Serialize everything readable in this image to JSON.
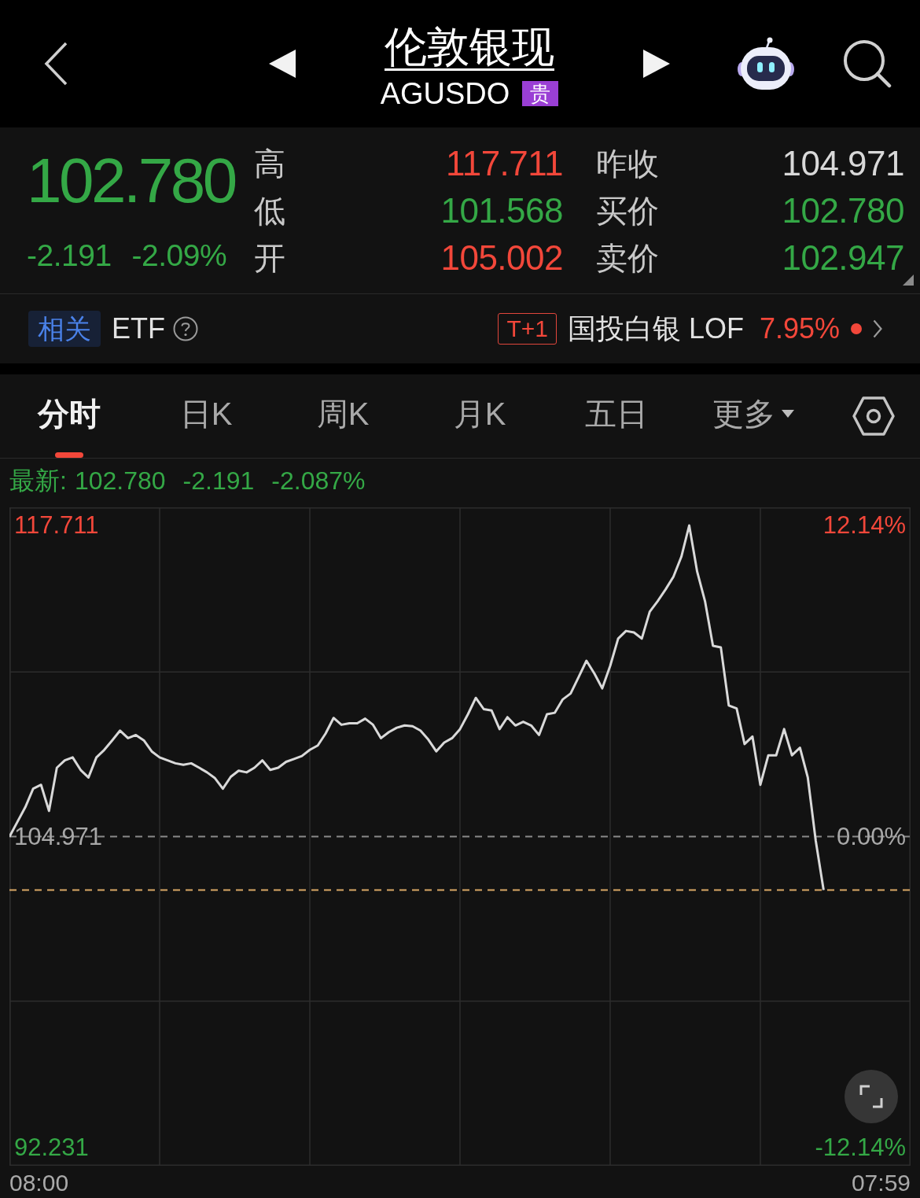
{
  "header": {
    "title": "伦敦银现",
    "code": "AGUSDO",
    "badge": "贵"
  },
  "quote": {
    "price": "102.780",
    "change": "-2.191",
    "percent": "-2.09%",
    "color": "#34a846",
    "stats": [
      {
        "label": "高",
        "value": "117.711",
        "color": "#f2473a"
      },
      {
        "label": "昨收",
        "value": "104.971",
        "color": "#d8d8d8"
      },
      {
        "label": "低",
        "value": "101.568",
        "color": "#34a846"
      },
      {
        "label": "买价",
        "value": "102.780",
        "color": "#34a846"
      },
      {
        "label": "开",
        "value": "105.002",
        "color": "#f2473a"
      },
      {
        "label": "卖价",
        "value": "102.947",
        "color": "#34a846"
      }
    ]
  },
  "related": {
    "tag": "相关",
    "label": "ETF",
    "fund": {
      "badge": "T+1",
      "name": "国投白银 LOF",
      "percent": "7.95%",
      "color": "#f2473a"
    }
  },
  "tabs": [
    {
      "label": "分时",
      "selected": true,
      "dropdown": false
    },
    {
      "label": "日K",
      "selected": false,
      "dropdown": false
    },
    {
      "label": "周K",
      "selected": false,
      "dropdown": false
    },
    {
      "label": "月K",
      "selected": false,
      "dropdown": false
    },
    {
      "label": "五日",
      "selected": false,
      "dropdown": false
    },
    {
      "label": "更多",
      "selected": false,
      "dropdown": true
    }
  ],
  "latest": {
    "label": "最新:",
    "price": "102.780",
    "change": "-2.191",
    "percent": "-2.087%",
    "color": "#34a846"
  },
  "chart": {
    "right_labels": [
      "12.14%",
      "0.00%",
      "-12.14%"
    ],
    "time_labels": [
      "08:00",
      "07:59"
    ],
    "chart_data": {
      "type": "line",
      "grid": true,
      "series": [
        {
          "color": "#d9d9d9",
          "values": [
            104.96,
            105.57,
            106.17,
            106.93,
            107.09,
            106.02,
            107.79,
            108.09,
            108.21,
            107.7,
            107.39,
            108.21,
            108.52,
            108.91,
            109.31,
            109.0,
            109.13,
            108.91,
            108.46,
            108.21,
            108.09,
            107.97,
            107.91,
            107.97,
            107.79,
            107.6,
            107.36,
            106.93,
            107.42,
            107.67,
            107.6,
            107.79,
            108.09,
            107.7,
            107.79,
            108.03,
            108.15,
            108.27,
            108.52,
            108.7,
            109.19,
            109.83,
            109.55,
            109.61,
            109.61,
            109.8,
            109.55,
            109.0,
            109.25,
            109.43,
            109.52,
            109.49,
            109.31,
            108.94,
            108.46,
            108.82,
            109.0,
            109.37,
            109.98,
            110.65,
            110.19,
            110.13,
            109.37,
            109.86,
            109.52,
            109.67,
            109.52,
            109.13,
            109.98,
            110.04,
            110.59,
            110.83,
            111.5,
            112.17,
            111.65,
            111.04,
            111.96,
            113.08,
            113.39,
            113.33,
            113.08,
            114.18,
            114.61,
            115.09,
            115.61,
            116.43,
            117.71,
            115.82,
            114.61,
            112.78,
            112.72,
            110.34,
            110.22,
            108.76,
            109.07,
            107.09,
            108.3,
            108.3,
            109.37,
            108.3,
            108.61,
            107.39,
            104.8,
            102.78,
            null,
            null,
            null,
            null,
            null,
            null,
            null,
            null,
            null,
            null,
            null
          ]
        }
      ],
      "ylim": [
        91.49,
        118.452
      ],
      "yticks": [
        {
          "value": 117.711,
          "label": "117.711"
        },
        {
          "value": 104.971,
          "label": "104.971"
        },
        {
          "value": 92.231,
          "label": "92.231"
        }
      ],
      "ref_lines": [
        {
          "axis": "y",
          "value": 104.971,
          "color": "#8a8a8a"
        },
        {
          "axis": "y",
          "value": 102.78,
          "color": "#d9a766"
        }
      ]
    }
  }
}
